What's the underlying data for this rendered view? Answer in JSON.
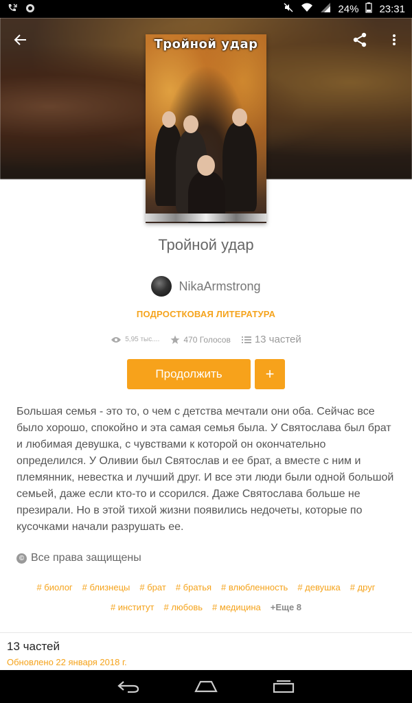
{
  "status_bar": {
    "battery": "24%",
    "time": "23:31",
    "icons": [
      "missed-call-icon",
      "notification-icon",
      "mute-icon",
      "wifi-icon",
      "signal-icon",
      "battery-icon"
    ]
  },
  "header": {
    "back_icon": "arrow-left-icon",
    "share_icon": "share-icon",
    "more_icon": "more-vertical-icon"
  },
  "book": {
    "cover_title": "Тройной удар",
    "title": "Тройной удар",
    "author": "NikaArmstrong",
    "category": "ПОДРОСТКОВАЯ ЛИТЕРАТУРА",
    "stats": {
      "reads": "5,95 тыс....",
      "votes": "470 Голосов",
      "parts": "13 частей"
    },
    "continue_label": "Продолжить",
    "add_label": "+",
    "description": "Большая семья - это то, о чем с детства мечтали они оба. Сейчас все было хорошо, спокойно и эта самая семья была. У Святослава был брат и любимая девушка, с чувствами к которой он окончательно определился. У Оливии был Святослав и ее брат, а вместе с ним и племянник, невестка и лучший друг. И все эти люди были одной большой семьей, даже если кто-то и ссорился. Даже Святослава больше не презирали. Но в этой тихой жизни появились недочеты, которые по кусочками начали разрушать ее.",
    "rights": "Все права защищены",
    "rights_icon": "©",
    "tags": [
      "# биолог",
      "# близнецы",
      "# брат",
      "# братья",
      "# влюбленность",
      "# девушка",
      "# друг",
      "# институт",
      "# любовь",
      "# медицина"
    ],
    "tags_more": "+Еще 8",
    "parts_title": "13 частей",
    "updated": "Обновлено 22 января 2018 г."
  },
  "colors": {
    "accent": "#f7a21b",
    "text": "#555555"
  },
  "nav": {
    "back": "nav-back-icon",
    "home": "nav-home-icon",
    "recents": "nav-recents-icon"
  }
}
